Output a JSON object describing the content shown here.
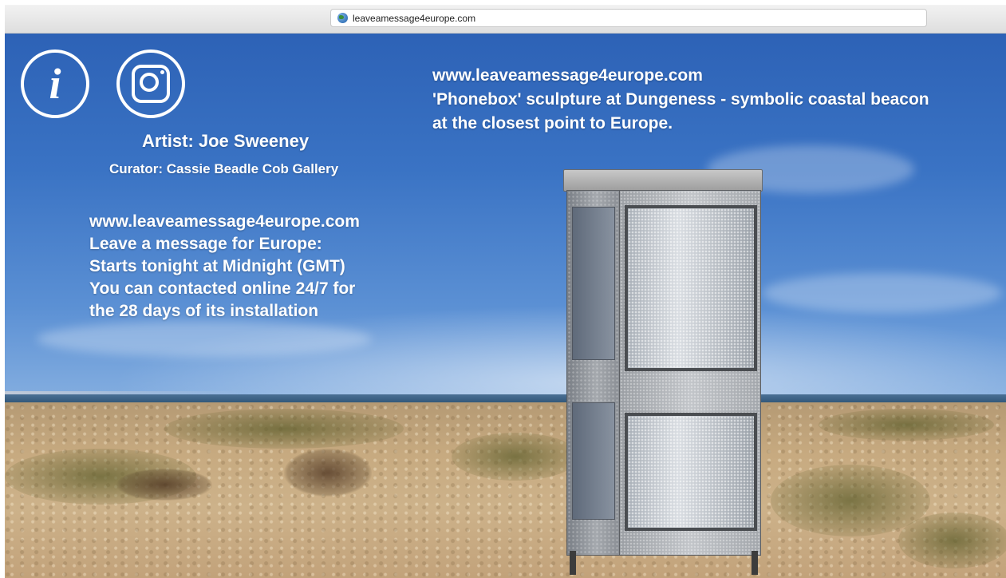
{
  "browser": {
    "url": "leaveamessage4europe.com",
    "url_icon": "globe-icon"
  },
  "overlay": {
    "info_icon": "info-icon",
    "info_glyph": "i",
    "instagram_icon": "instagram-icon",
    "artist": "Artist: Joe Sweeney",
    "curator": "Curator: Cassie Beadle Cob Gallery",
    "left_block": [
      "www.leaveamessage4europe.com",
      "Leave a message for Europe:",
      "Starts tonight at Midnight (GMT)",
      "You can contacted online 24/7 for",
      "the 28 days of its installation"
    ],
    "right_block": [
      "www.leaveamessage4europe.com",
      "'Phonebox'  sculpture at Dungeness - symbolic coastal beacon",
      "at the closest point to Europe."
    ]
  },
  "colors": {
    "text": "#ffffff",
    "sky": "#3a73c4",
    "beach": "#c7aa80"
  }
}
